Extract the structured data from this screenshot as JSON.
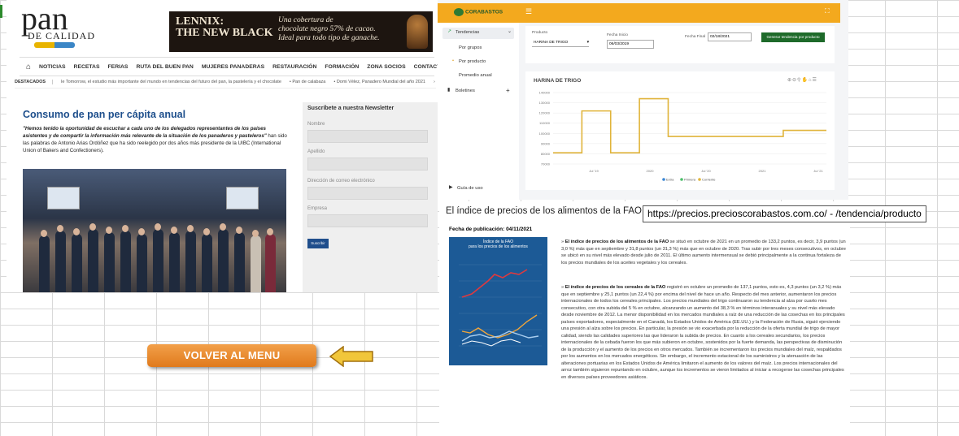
{
  "pan_de_calidad": {
    "logo_main": "pan",
    "logo_sub": "DE CALIDAD",
    "ad": {
      "headline_1": "LENNIX:",
      "headline_2": "THE NEW BLACK",
      "tagline_1": "Una cobertura de",
      "tagline_2": "chocolate negro 57% de cacao.",
      "tagline_3": "Ideal para todo tipo de ganache."
    },
    "nav": [
      "NOTICIAS",
      "RECETAS",
      "FERIAS",
      "RUTA DEL BUEN PAN",
      "MUJERES PANADERAS",
      "RESTAURACIÓN",
      "FORMACIÓN",
      "ZONA SOCIOS",
      "CONTACTO"
    ],
    "ticker": {
      "label": "DESTACADOS",
      "items": [
        "le Tomorrow, el estudio más importante del mundo en tendencias del futuro del pan, la pastelería y el chocolate",
        "Pan de calabaza",
        "Domi Vélez, Panadero Mundial del año 2021"
      ]
    },
    "article": {
      "title": "Consumo de pan per cápita anual",
      "lead_bold": "\"Hemos tenido la oportunidad de escuchar a cada uno de los delegados representantes de los países asistentes y de compartir la información más relevante de la situación de los panaderos y pasteleros\"",
      "lead_rest": " han sido las palabras de Antonio Arias Ordóñez que ha sido reelegido por dos años más presidente de la UIBC (International Union of Bakers and Confectioners)."
    },
    "newsletter": {
      "title": "Suscríbete a nuestra Newsletter",
      "fields": [
        "Nombre",
        "Apellido",
        "Dirección de correo electrónico",
        "Empresa"
      ],
      "submit": "Suscribir"
    }
  },
  "corabastos": {
    "logo": "CORABASTOS",
    "sidebar": {
      "tendencias": "Tendencias",
      "por_grupos": "Por grupos",
      "por_producto": "Por producto",
      "promedio_anual": "Promedio anual",
      "boletines": "Boletines",
      "guia": "Guía de uso"
    },
    "filters": {
      "producto_label": "Producto",
      "producto_value": "HARINA DE TRIGO",
      "fecha_inicio_label": "Fecha Inicio",
      "fecha_inicio_value": "06/03/2019",
      "fecha_final_label": "Fecha Final",
      "fecha_final_value": "02/18/2021",
      "generate": "Generar tendencia por producto"
    },
    "chart_title": "HARINA DE TRIGO",
    "chart_data": {
      "type": "line",
      "title": "HARINA DE TRIGO",
      "y_ticks": [
        "140000",
        "130000",
        "120000",
        "110000",
        "100000",
        "90000",
        "80000",
        "70000"
      ],
      "x_ticks": [
        "Jul '19",
        "2020",
        "Jul '20",
        "2021",
        "Jul '21"
      ],
      "legend": [
        "Extra",
        "Primera",
        "Corriente"
      ],
      "legend_colors": [
        "#3a86d4",
        "#4cbf6a",
        "#e0b43a"
      ],
      "series": [
        {
          "name": "Corriente",
          "values": [
            81000,
            81000,
            122000,
            122000,
            81000,
            81000,
            134000,
            134000,
            97000,
            97000,
            97000,
            97000,
            97000,
            97000,
            97000,
            97000,
            103000,
            103000,
            103000,
            103000
          ]
        }
      ],
      "ylim": [
        70000,
        140000
      ]
    }
  },
  "fao": {
    "title": "El índice de precios de los alimentos de la FAO a",
    "url": "https://precios.precioscorabastos.com.co/ - /tendencia/producto",
    "fecha": "Fecha de publicación: 04/11/2021",
    "figure_title_1": "Índice de la FAO",
    "figure_title_2": "para los precios de los alimentos",
    "p1_bold": "El índice de precios de los alimentos de la FAO",
    "p1_rest": " se situó en octubre de 2021 en un promedio de 133,2 puntos, es decir, 3,9 puntos (un 3,0 %) más que en septiembre y 31,8 puntos (un 31,3 %) más que en octubre de 2020. Tras subir por tres meses consecutivos, en octubre se ubicó en su nivel más elevado desde julio de 2011. El último aumento intermensual se debió principalmente a la continua fortaleza de los precios mundiales de los aceites vegetales y los cereales.",
    "p2_bold": "El índice de precios de los cereales de la FAO",
    "p2_rest": " registró en octubre un promedio de 137,1 puntos, esto es, 4,3 puntos (un 3,2 %) más que en septiembre y 25,1 puntos (un 22,4 %) por encima del nivel de hace un año. Respecto del mes anterior, aumentaron los precios internacionales de todos los cereales principales. Los precios mundiales del trigo continuaron su tendencia al alza por cuarto mes consecutivo, con otra subida del 5 % en octubre, alcanzando un aumento del 38,3 % en términos interanuales y su nivel más elevado desde noviembre de 2012. La menor disponibilidad en los mercados mundiales a raíz de una reducción de las cosechas en los principales países exportadores, especialmente en el Canadá, los Estados Unidos de América (EE.UU.) y la Federación de Rusia, siguió ejerciendo una presión al alza sobre los precios. En particular, la presión se vio exacerbada por la reducción de la oferta mundial de trigo de mayor calidad, siendo las calidades superiores las que lideraron la subida de precios. En cuanto a los cereales secundarios, los precios internacionales de la cebada fueron los que más subieron en octubre, sostenidos por la fuerte demanda, las perspectivas de disminución de la producción y el aumento de los precios en otros mercados. También se incrementaron los precios mundiales del maíz, respaldados por los aumentos en los mercados energéticos. Sin embargo, el incremento estacional de los suministros y la atenuación de las alteraciones portuarias en los Estados Unidos de América limitaron el aumento de los valores del maíz. Los precios internacionales del arroz también siguieron repuntando en octubre, aunque los incrementos se vieron limitados al iniciar a recogerse las cosechas principales en diversos países proveedores asiáticos."
  },
  "menu_button": "VOLVER AL MENU"
}
